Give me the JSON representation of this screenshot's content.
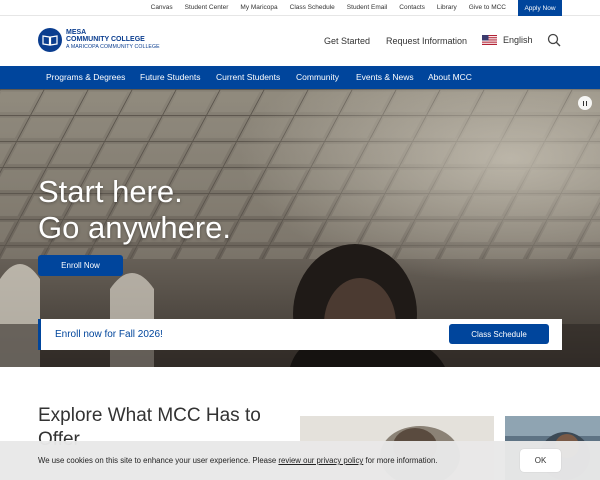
{
  "utility": {
    "links": [
      "Canvas",
      "Student Center",
      "My Maricopa",
      "Class Schedule",
      "Student Email",
      "Contacts",
      "Library",
      "Give to MCC"
    ],
    "apply_label": "Apply Now"
  },
  "header": {
    "logo": {
      "line1": "MESA",
      "line2": "COMMUNITY COLLEGE",
      "line3": "A MARICOPA COMMUNITY COLLEGE"
    },
    "get_started": "Get Started",
    "request_info": "Request Information",
    "language": "English"
  },
  "nav": {
    "items": [
      "Programs & Degrees",
      "Future Students",
      "Current Students",
      "Community",
      "Events & News",
      "About MCC"
    ]
  },
  "hero": {
    "title_line1": "Start here.",
    "title_line2": "Go anywhere.",
    "enroll_label": "Enroll Now",
    "strip_text": "Enroll now for Fall 2026!",
    "class_schedule_label": "Class Schedule"
  },
  "explore": {
    "title": "Explore What MCC Has to Offer"
  },
  "cookie": {
    "text_before": "We use cookies on this site to enhance your user experience. Please ",
    "link_text": "review our privacy policy",
    "text_after": " for more information.",
    "ok_label": "OK"
  },
  "colors": {
    "brand_blue": "#00459c",
    "logo_blue": "#0a3d8f"
  },
  "icons": {
    "search": "magnifier",
    "pause": "pause",
    "flag": "us-flag"
  }
}
